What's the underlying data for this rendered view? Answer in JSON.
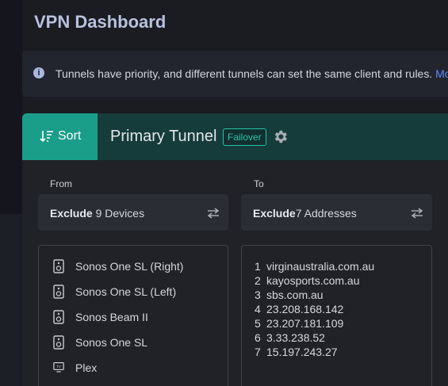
{
  "page": {
    "title": "VPN Dashboard"
  },
  "info_banner": {
    "text": "Tunnels have priority, and different tunnels can set the same client and rules.",
    "link": "Mo"
  },
  "tunnel": {
    "sort_label": "Sort",
    "name": "Primary Tunnel",
    "badge": "Failover",
    "from": {
      "label": "From",
      "mode": "Exclude",
      "summary": "9 Devices",
      "devices": [
        {
          "name": "Sonos One SL (Right)",
          "icon": "speaker-icon"
        },
        {
          "name": "Sonos One SL (Left)",
          "icon": "speaker-icon"
        },
        {
          "name": "Sonos Beam II",
          "icon": "speaker-icon"
        },
        {
          "name": "Sonos One SL",
          "icon": "speaker-icon"
        },
        {
          "name": "Plex",
          "icon": "tv-icon"
        }
      ]
    },
    "to": {
      "label": "To",
      "mode": "Exclude",
      "summary": "7 Addresses",
      "addresses": [
        {
          "num": "1",
          "value": "virginaustralia.com.au"
        },
        {
          "num": "2",
          "value": "kayosports.com.au"
        },
        {
          "num": "3",
          "value": "sbs.com.au"
        },
        {
          "num": "4",
          "value": "23.208.168.142"
        },
        {
          "num": "5",
          "value": "23.207.181.109"
        },
        {
          "num": "6",
          "value": "3.33.238.52"
        },
        {
          "num": "7",
          "value": "15.197.243.27"
        }
      ]
    }
  },
  "colors": {
    "accent": "#1a9e8a",
    "header": "#153b3a",
    "badge": "#27c2a7",
    "link": "#5a8dff"
  }
}
